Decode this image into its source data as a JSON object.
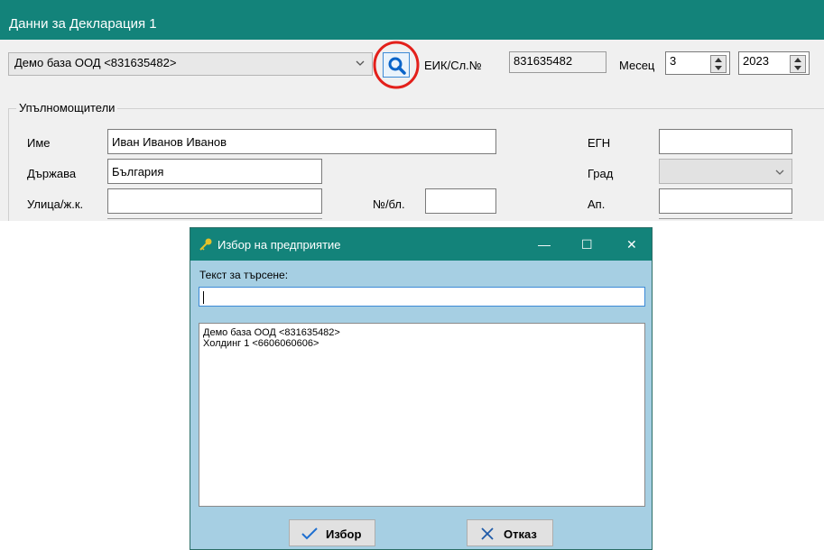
{
  "main": {
    "title": "Данни за Декларация 1",
    "company_combo": "Демо база ООД <831635482>",
    "eik_label": "ЕИК/Сл.№",
    "eik_value": "831635482",
    "month_label": "Месец",
    "month_value": "3",
    "year_value": "2023",
    "section_label": "Упълномощители",
    "fields": {
      "name_label": "Име",
      "name_value": "Иван Иванов Иванов",
      "egn_label": "ЕГН",
      "egn_value": "",
      "country_label": "Държава",
      "country_value": "България",
      "city_label": "Град",
      "city_value": "",
      "street_label": "Улица/ж.к.",
      "street_value": "",
      "number_label": "№/бл.",
      "number_value": "",
      "apt_label": "Ап.",
      "apt_value": ""
    }
  },
  "dialog": {
    "title": "Избор на предприятие",
    "search_label": "Текст за търсене:",
    "search_value": "",
    "items": [
      "Демо база ООД <831635482>",
      "Холдинг 1 <6606060606>"
    ],
    "select_label": "Избор",
    "cancel_label": "Отказ",
    "minimize_glyph": "—",
    "maximize_glyph": "☐",
    "close_glyph": "✕"
  },
  "colors": {
    "titlebar": "#13837a",
    "dialog_bg": "#a6cfe3",
    "highlight_circle": "#e3201b",
    "search_icon": "#0a64c8"
  }
}
